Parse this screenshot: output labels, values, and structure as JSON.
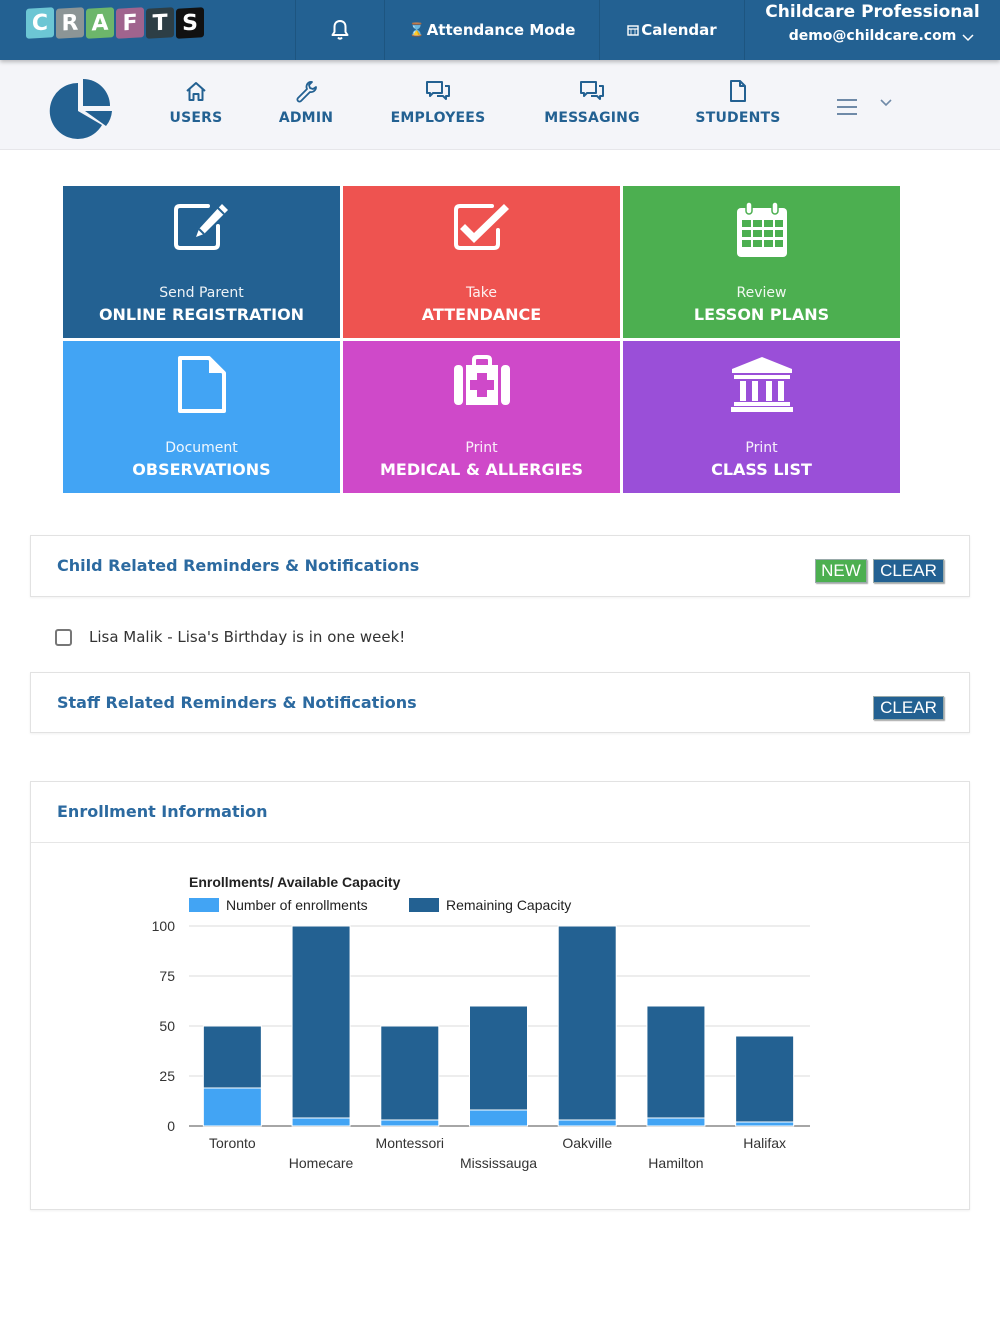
{
  "topbar": {
    "logo_letters": [
      {
        "char": "C",
        "color": "#6cc6d4"
      },
      {
        "char": "R",
        "color": "#8c9596"
      },
      {
        "char": "A",
        "color": "#6db66b"
      },
      {
        "char": "F",
        "color": "#a0648e"
      },
      {
        "char": "T",
        "color": "#2d3e45"
      },
      {
        "char": "S",
        "color": "#111111"
      }
    ],
    "notifications_icon": "bell-icon",
    "attendance_mode_label": "Attendance Mode",
    "attendance_mode_icon": "hourglass-icon",
    "calendar_label": "Calendar",
    "calendar_icon": "calendar-icon",
    "user_name": "Childcare Professional",
    "user_email": "demo@childcare.com"
  },
  "nav": {
    "items": [
      {
        "label": "USERS",
        "icon": "home-icon"
      },
      {
        "label": "ADMIN",
        "icon": "wrench-icon"
      },
      {
        "label": "EMPLOYEES",
        "icon": "chat-icon"
      },
      {
        "label": "MESSAGING",
        "icon": "chat-icon"
      },
      {
        "label": "STUDENTS",
        "icon": "document-icon"
      }
    ]
  },
  "tiles": [
    {
      "sub": "Send Parent",
      "main": "ONLINE REGISTRATION",
      "color": "#236192",
      "icon": "edit-icon"
    },
    {
      "sub": "Take",
      "main": "ATTENDANCE",
      "color": "#ee5350",
      "icon": "checkbox-icon"
    },
    {
      "sub": "Review",
      "main": "LESSON PLANS",
      "color": "#4caf50",
      "icon": "calendar-icon"
    },
    {
      "sub": "Document",
      "main": "OBSERVATIONS",
      "color": "#42a4f4",
      "icon": "document-icon"
    },
    {
      "sub": "Print",
      "main": "MEDICAL & ALLERGIES",
      "color": "#cf49c9",
      "icon": "medkit-icon"
    },
    {
      "sub": "Print",
      "main": "CLASS LIST",
      "color": "#9a4fd8",
      "icon": "institution-icon"
    }
  ],
  "child_reminders": {
    "title": "Child Related Reminders & Notifications",
    "new_label": "NEW",
    "clear_label": "CLEAR",
    "items": [
      {
        "text": "Lisa Malik - Lisa's Birthday is in one week!",
        "checked": false
      }
    ]
  },
  "staff_reminders": {
    "title": "Staff Related Reminders & Notifications",
    "clear_label": "CLEAR"
  },
  "enrollment": {
    "title": "Enrollment Information"
  },
  "chart_data": {
    "type": "bar",
    "stacked": true,
    "title": "Enrollments/ Available Capacity",
    "xlabel": "",
    "ylabel": "",
    "categories": [
      "Toronto",
      "Homecare",
      "Montessori",
      "Mississauga",
      "Oakville",
      "Hamilton",
      "Halifax"
    ],
    "series": [
      {
        "name": "Number of enrollments",
        "color": "#42a4f4",
        "values": [
          19,
          4,
          3,
          8,
          3,
          4,
          2
        ]
      },
      {
        "name": "Remaining Capacity",
        "color": "#236192",
        "values": [
          31,
          96,
          47,
          52,
          97,
          56,
          43
        ]
      }
    ],
    "ylim": [
      0,
      100
    ],
    "yticks": [
      0,
      25,
      50,
      75,
      100
    ],
    "grid": true,
    "legend_position": "top-left"
  }
}
